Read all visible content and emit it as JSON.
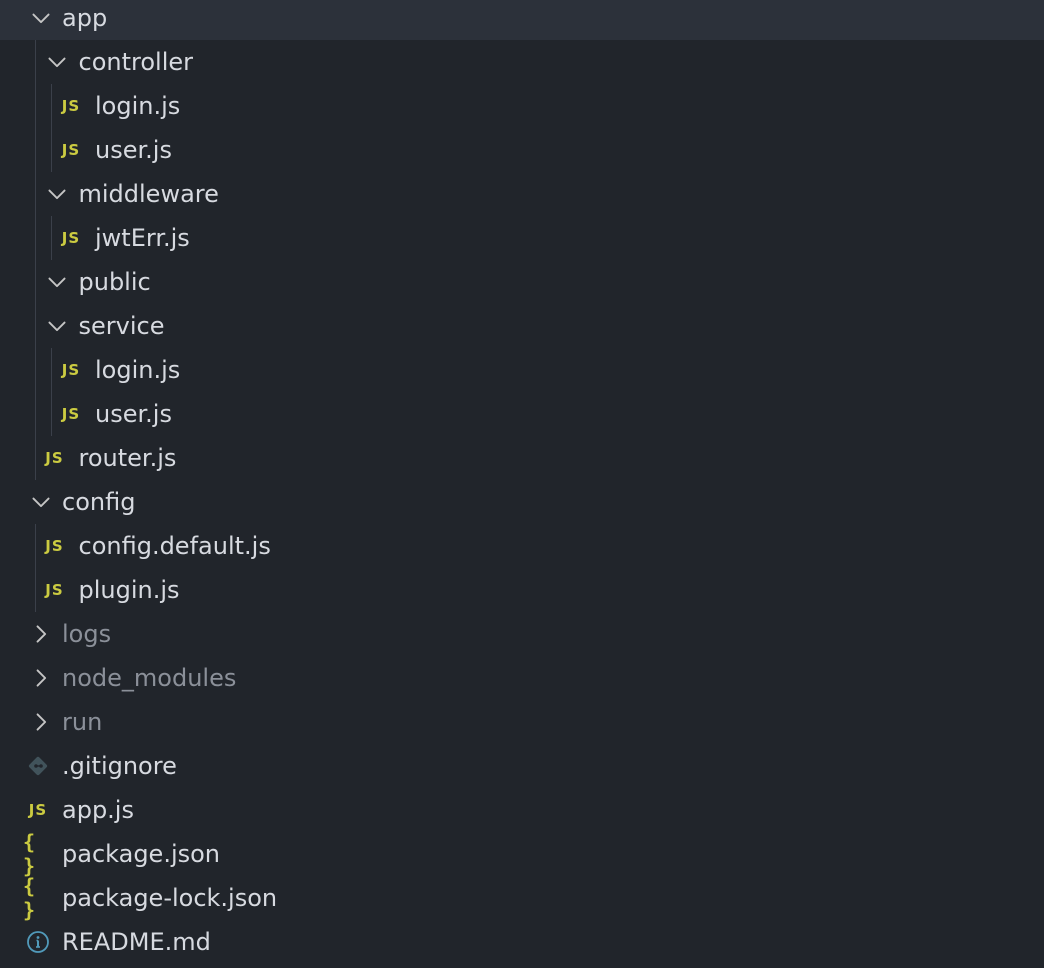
{
  "explorer": {
    "colors": {
      "background": "#21252b",
      "text": "#d7dae0",
      "muted_text": "#8b9099",
      "js_icon": "#cbcb41",
      "json_icon": "#cbcb41",
      "git_icon": "#41535b",
      "info_icon": "#519aba",
      "chevron": "#c5c5c5"
    },
    "rows": [
      {
        "label": "app",
        "kind": "folder",
        "expanded": true,
        "depth": 1,
        "icon": "chevron-down-icon"
      },
      {
        "label": "controller",
        "kind": "folder",
        "expanded": true,
        "depth": 2,
        "icon": "chevron-down-icon"
      },
      {
        "label": "login.js",
        "kind": "file",
        "depth": 3,
        "icon": "js-file-icon",
        "icon_text": "JS"
      },
      {
        "label": "user.js",
        "kind": "file",
        "depth": 3,
        "icon": "js-file-icon",
        "icon_text": "JS"
      },
      {
        "label": "middleware",
        "kind": "folder",
        "expanded": true,
        "depth": 2,
        "icon": "chevron-down-icon"
      },
      {
        "label": "jwtErr.js",
        "kind": "file",
        "depth": 3,
        "icon": "js-file-icon",
        "icon_text": "JS"
      },
      {
        "label": "public",
        "kind": "folder",
        "expanded": true,
        "depth": 2,
        "icon": "chevron-down-icon"
      },
      {
        "label": "service",
        "kind": "folder",
        "expanded": true,
        "depth": 2,
        "icon": "chevron-down-icon"
      },
      {
        "label": "login.js",
        "kind": "file",
        "depth": 3,
        "icon": "js-file-icon",
        "icon_text": "JS"
      },
      {
        "label": "user.js",
        "kind": "file",
        "depth": 3,
        "icon": "js-file-icon",
        "icon_text": "JS"
      },
      {
        "label": "router.js",
        "kind": "file",
        "depth": 2,
        "icon": "js-file-icon",
        "icon_text": "JS"
      },
      {
        "label": "config",
        "kind": "folder",
        "expanded": true,
        "depth": 1,
        "icon": "chevron-down-icon"
      },
      {
        "label": "config.default.js",
        "kind": "file",
        "depth": 2,
        "icon": "js-file-icon",
        "icon_text": "JS"
      },
      {
        "label": "plugin.js",
        "kind": "file",
        "depth": 2,
        "icon": "js-file-icon",
        "icon_text": "JS"
      },
      {
        "label": "logs",
        "kind": "folder",
        "expanded": false,
        "muted": true,
        "depth": 1,
        "icon": "chevron-right-icon"
      },
      {
        "label": "node_modules",
        "kind": "folder",
        "expanded": false,
        "muted": true,
        "depth": 1,
        "icon": "chevron-right-icon"
      },
      {
        "label": "run",
        "kind": "folder",
        "expanded": false,
        "muted": true,
        "depth": 1,
        "icon": "chevron-right-icon"
      },
      {
        "label": ".gitignore",
        "kind": "file",
        "depth": 1,
        "icon": "git-file-icon"
      },
      {
        "label": "app.js",
        "kind": "file",
        "depth": 1,
        "icon": "js-file-icon",
        "icon_text": "JS"
      },
      {
        "label": "package.json",
        "kind": "file",
        "depth": 1,
        "icon": "json-file-icon",
        "icon_text": "{ }"
      },
      {
        "label": "package-lock.json",
        "kind": "file",
        "depth": 1,
        "icon": "json-file-icon",
        "icon_text": "{ }"
      },
      {
        "label": "README.md",
        "kind": "file",
        "depth": 1,
        "icon": "info-file-icon"
      }
    ]
  }
}
